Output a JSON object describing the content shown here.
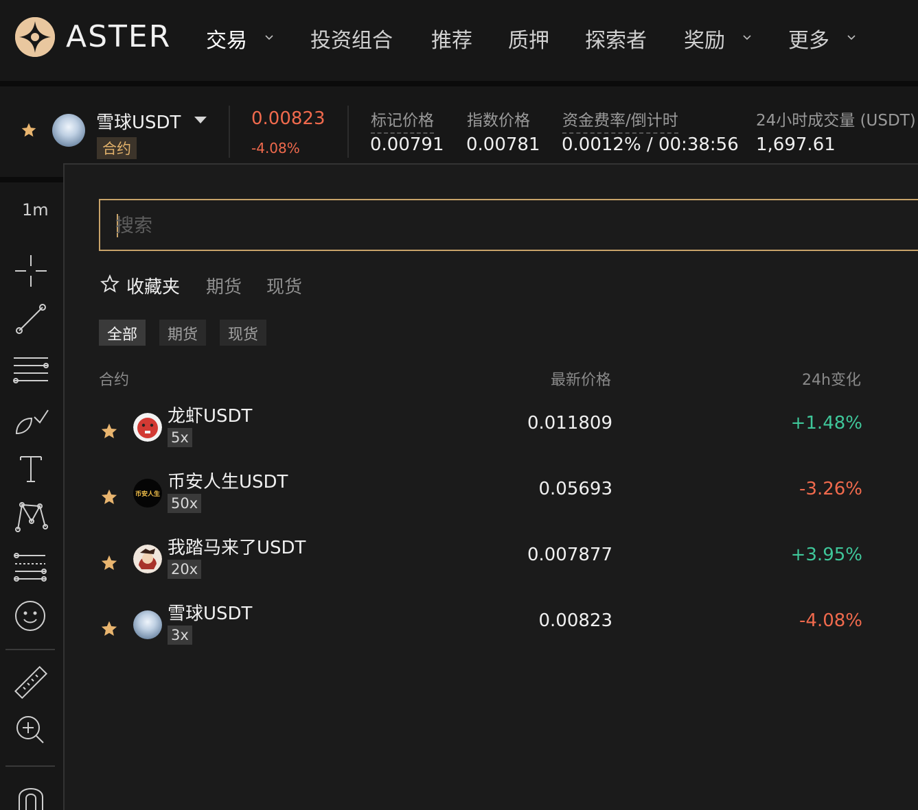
{
  "brand": {
    "name": "ASTER",
    "accent": "#e9c79f"
  },
  "nav": {
    "items": [
      {
        "label": "交易",
        "has_dropdown": true,
        "active": true
      },
      {
        "label": "投资组合",
        "has_dropdown": false
      },
      {
        "label": "推荐",
        "has_dropdown": false
      },
      {
        "label": "质押",
        "has_dropdown": false
      },
      {
        "label": "探索者",
        "has_dropdown": false
      },
      {
        "label": "奖励",
        "has_dropdown": true
      },
      {
        "label": "更多",
        "has_dropdown": true
      }
    ]
  },
  "ticker": {
    "symbol": "雪球USDT",
    "type_badge": "合约",
    "last_price": "0.00823",
    "change_24h": "-4.08%",
    "stats": [
      {
        "label": "标记价格",
        "value": "0.00791"
      },
      {
        "label": "指数价格",
        "value": "0.00781"
      },
      {
        "label": "资金费率/倒计时",
        "value": "0.0012% / 00:38:56"
      },
      {
        "label": "24小时成交量 (USDT)",
        "value": "1,697.61"
      }
    ]
  },
  "toolbar": {
    "timeframe": "1m"
  },
  "market_selector": {
    "search": {
      "placeholder": "搜索",
      "value": ""
    },
    "category_tabs": [
      {
        "label": "收藏夹",
        "active": true
      },
      {
        "label": "期货",
        "active": false
      },
      {
        "label": "现货",
        "active": false
      }
    ],
    "filter_chips": [
      {
        "label": "全部",
        "active": true
      },
      {
        "label": "期货",
        "active": false
      },
      {
        "label": "现货",
        "active": false
      }
    ],
    "columns": {
      "contract": "合约",
      "last_price": "最新价格",
      "change": "24h变化"
    },
    "rows": [
      {
        "symbol": "龙虾USDT",
        "leverage": "5x",
        "price": "0.011809",
        "change": "+1.48%",
        "direction": "up",
        "avatar": "red-lobster"
      },
      {
        "symbol": "币安人生USDT",
        "leverage": "50x",
        "price": "0.05693",
        "change": "-3.26%",
        "direction": "down",
        "avatar": "text-logo",
        "avatar_text": "币安人生"
      },
      {
        "symbol": "我踏马来了USDT",
        "leverage": "20x",
        "price": "0.007877",
        "change": "+3.95%",
        "direction": "up",
        "avatar": "character"
      },
      {
        "symbol": "雪球USDT",
        "leverage": "3x",
        "price": "0.00823",
        "change": "-4.08%",
        "direction": "down",
        "avatar": "snowball"
      }
    ]
  },
  "colors": {
    "up": "#3fc79a",
    "down": "#f06a4d",
    "star": "#e9b56f",
    "search_border": "#c9a46a"
  }
}
